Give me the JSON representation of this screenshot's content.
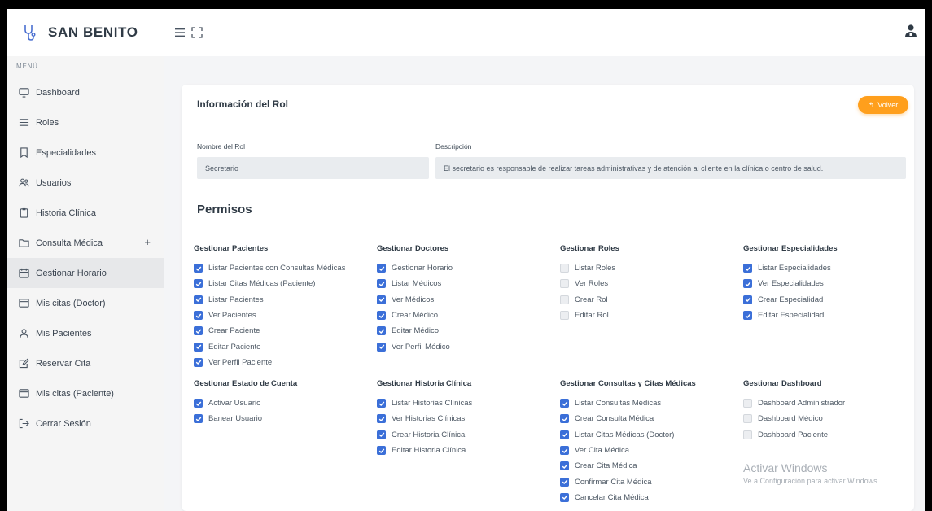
{
  "brand": {
    "name": "SAN BENITO"
  },
  "menu": {
    "title": "MENÚ",
    "items": [
      {
        "label": "Dashboard",
        "icon": "monitor-icon",
        "active": false
      },
      {
        "label": "Roles",
        "icon": "list-icon",
        "active": false
      },
      {
        "label": "Especialidades",
        "icon": "bookmark-icon",
        "active": false
      },
      {
        "label": "Usuarios",
        "icon": "users-icon",
        "active": false
      },
      {
        "label": "Historia Clínica",
        "icon": "clipboard-icon",
        "active": false
      },
      {
        "label": "Consulta Médica",
        "icon": "folder-icon",
        "active": false,
        "expand": "+"
      },
      {
        "label": "Gestionar Horario",
        "icon": "calendar-icon",
        "active": true
      },
      {
        "label": "Mis citas (Doctor)",
        "icon": "calendar-outline-icon",
        "active": false
      },
      {
        "label": "Mis Pacientes",
        "icon": "user-icon",
        "active": false
      },
      {
        "label": "Reservar Cita",
        "icon": "edit-icon",
        "active": false
      },
      {
        "label": "Mis citas (Paciente)",
        "icon": "calendar-outline-icon",
        "active": false
      },
      {
        "label": "Cerrar Sesión",
        "icon": "logout-icon",
        "active": false
      }
    ]
  },
  "card": {
    "title": "Información del Rol",
    "back_label": "Volver",
    "role_name_label": "Nombre del Rol",
    "role_name_value": "Secretario",
    "description_label": "Descripción",
    "description_value": "El secretario es responsable de realizar tareas administrativas y de atención al cliente en la clínica o centro de salud.",
    "permissions_title": "Permisos"
  },
  "permission_groups": [
    {
      "title": "Gestionar Pacientes",
      "items": [
        {
          "label": "Listar Pacientes con Consultas Médicas",
          "checked": true
        },
        {
          "label": "Listar Citas Médicas (Paciente)",
          "checked": true
        },
        {
          "label": "Listar Pacientes",
          "checked": true
        },
        {
          "label": "Ver Pacientes",
          "checked": true
        },
        {
          "label": "Crear Paciente",
          "checked": true
        },
        {
          "label": "Editar Paciente",
          "checked": true
        },
        {
          "label": "Ver Perfil Paciente",
          "checked": true
        }
      ]
    },
    {
      "title": "Gestionar Doctores",
      "items": [
        {
          "label": "Gestionar Horario",
          "checked": true
        },
        {
          "label": "Listar Médicos",
          "checked": true
        },
        {
          "label": "Ver Médicos",
          "checked": true
        },
        {
          "label": "Crear Médico",
          "checked": true
        },
        {
          "label": "Editar Médico",
          "checked": true
        },
        {
          "label": "Ver Perfil Médico",
          "checked": true
        }
      ]
    },
    {
      "title": "Gestionar Roles",
      "items": [
        {
          "label": "Listar Roles",
          "checked": false
        },
        {
          "label": "Ver Roles",
          "checked": false
        },
        {
          "label": "Crear Rol",
          "checked": false
        },
        {
          "label": "Editar Rol",
          "checked": false
        }
      ]
    },
    {
      "title": "Gestionar Especialidades",
      "items": [
        {
          "label": "Listar Especialidades",
          "checked": true
        },
        {
          "label": "Ver Especialidades",
          "checked": true
        },
        {
          "label": "Crear Especialidad",
          "checked": true
        },
        {
          "label": "Editar Especialidad",
          "checked": true
        }
      ]
    },
    {
      "title": "Gestionar Estado de Cuenta",
      "items": [
        {
          "label": "Activar Usuario",
          "checked": true
        },
        {
          "label": "Banear Usuario",
          "checked": true
        }
      ]
    },
    {
      "title": "Gestionar Historia Clínica",
      "items": [
        {
          "label": "Listar Historias Clínicas",
          "checked": true
        },
        {
          "label": "Ver Historias Clínicas",
          "checked": true
        },
        {
          "label": "Crear Historia Clínica",
          "checked": true
        },
        {
          "label": "Editar Historia Clínica",
          "checked": true
        }
      ]
    },
    {
      "title": "Gestionar Consultas y Citas Médicas",
      "items": [
        {
          "label": "Listar Consultas Médicas",
          "checked": true
        },
        {
          "label": "Crear Consulta Médica",
          "checked": true
        },
        {
          "label": "Listar Citas Médicas (Doctor)",
          "checked": true
        },
        {
          "label": "Ver Cita Médica",
          "checked": true
        },
        {
          "label": "Crear Cita Médica",
          "checked": true
        },
        {
          "label": "Confirmar Cita Médica",
          "checked": true
        },
        {
          "label": "Cancelar Cita Médica",
          "checked": true
        }
      ]
    },
    {
      "title": "Gestionar Dashboard",
      "items": [
        {
          "label": "Dashboard Administrador",
          "checked": false
        },
        {
          "label": "Dashboard Médico",
          "checked": false
        },
        {
          "label": "Dashboard Paciente",
          "checked": false
        }
      ]
    }
  ],
  "watermark": {
    "line1": "Activar Windows",
    "line2": "Ve a Configuración para activar Windows."
  },
  "colors": {
    "accent": "#ff9f1c",
    "checkbox": "#3b6fd8",
    "sidebar_active": "#e7e8ea"
  }
}
